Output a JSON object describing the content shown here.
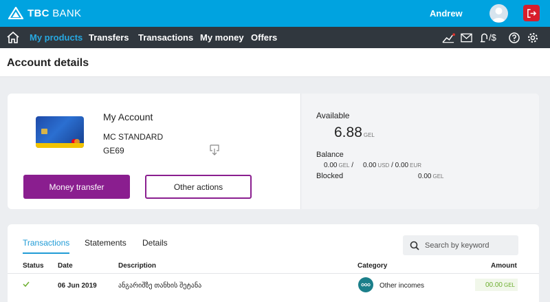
{
  "topbar": {
    "logo_text_bold": "TBC",
    "logo_text": "BANK",
    "username": "Andrew"
  },
  "nav": {
    "items": [
      "My products",
      "Transfers",
      "Transactions",
      "My money",
      "Offers"
    ],
    "currency_label": "/$"
  },
  "page": {
    "title": "Account details"
  },
  "account": {
    "name": "My Account",
    "type": "MC STANDARD",
    "iban": "GE69",
    "money_transfer_label": "Money transfer",
    "other_actions_label": "Other actions",
    "available_label": "Available",
    "available_amount": "6.88",
    "available_currency": "GEL",
    "balance_label": "Balance",
    "balance_gel": "0.00",
    "balance_gel_cur": "GEL",
    "balance_sep": "/",
    "balance_usd": "0.00",
    "balance_usd_cur": "USD",
    "balance_eur": "/ 0.00",
    "balance_eur_cur": "EUR",
    "blocked_label": "Blocked",
    "blocked_amount": "0.00",
    "blocked_currency": "GEL"
  },
  "transactions": {
    "tabs": [
      "Transactions",
      "Statements",
      "Details"
    ],
    "search_placeholder": "Search by keyword",
    "columns": [
      "Status",
      "Date",
      "Description",
      "Category",
      "Amount"
    ],
    "rows": [
      {
        "date": "06 Jun 2019",
        "description": "ანგარიშზე თანხის შეტანა",
        "category": "Other incomes",
        "amount": "00.00",
        "currency": "GEL"
      }
    ]
  },
  "colors": {
    "topbar": "#00a3e0",
    "navbar": "#30373e",
    "accent": "#8a1e8f",
    "active_tab": "#1f9bd6",
    "amount_positive": "#6cae2e"
  }
}
